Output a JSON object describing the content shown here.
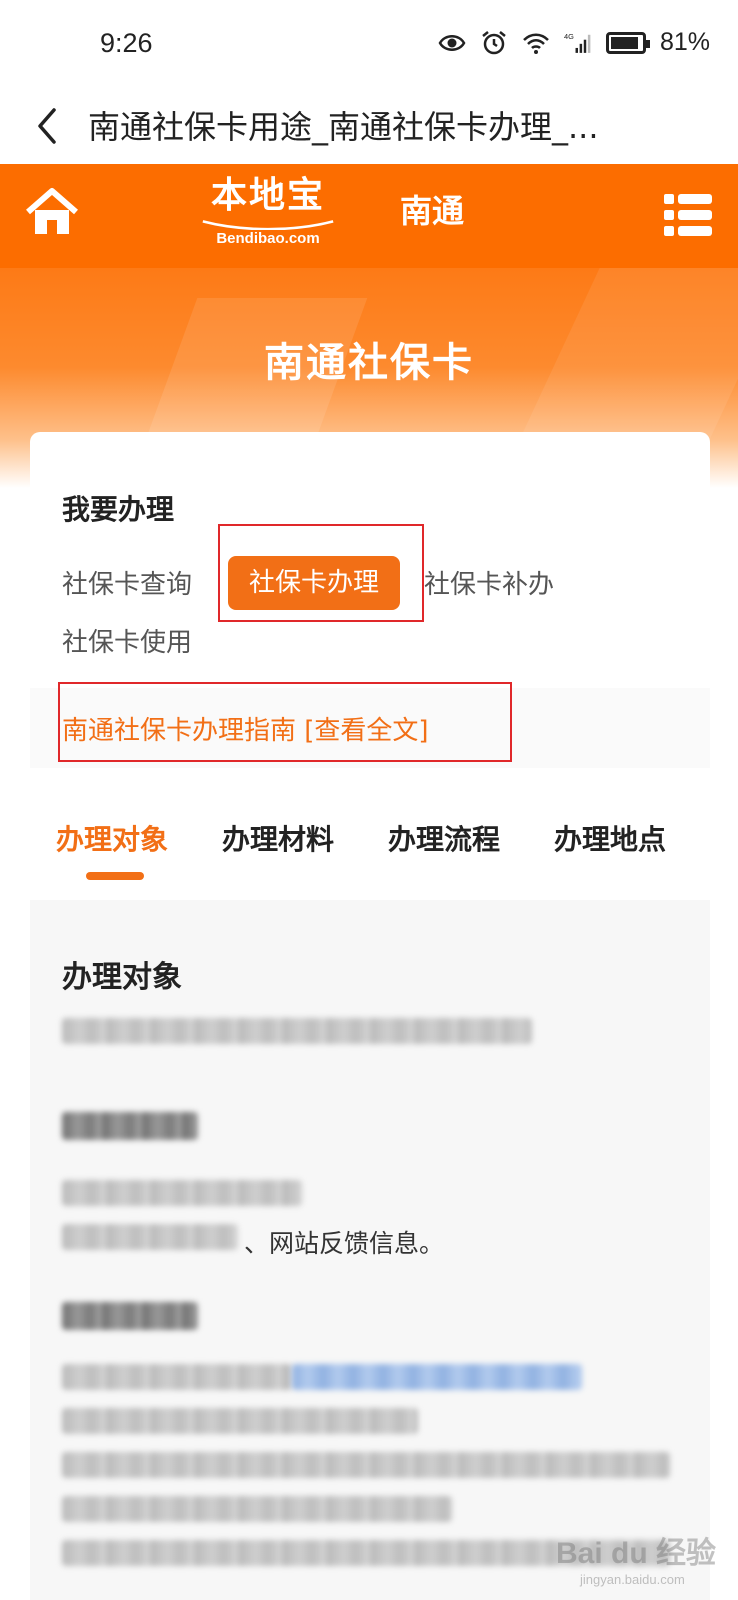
{
  "status_bar": {
    "time": "9:26",
    "battery": "81%",
    "network": "4G"
  },
  "title_bar": {
    "title": "南通社保卡用途_南通社保卡办理_..."
  },
  "header": {
    "logo_text": "本地宝",
    "logo_domain": "Bendibao.com",
    "city": "南通",
    "brand_color": "#fc6d00"
  },
  "hero": {
    "title": "南通社保卡"
  },
  "card": {
    "heading": "我要办理",
    "options": [
      {
        "label": "社保卡查询",
        "active": false
      },
      {
        "label": "社保卡办理",
        "active": true
      },
      {
        "label": "社保卡补办",
        "active": false
      },
      {
        "label": "社保卡使用",
        "active": false
      }
    ],
    "guide_link": "南通社保卡办理指南 [查看全文]"
  },
  "tabs": [
    {
      "label": "办理对象",
      "active": true
    },
    {
      "label": "办理材料",
      "active": false
    },
    {
      "label": "办理流程",
      "active": false
    },
    {
      "label": "办理地点",
      "active": false
    }
  ],
  "content": {
    "heading": "办理对象",
    "visible_fragment": "、网站反馈信息。"
  },
  "watermark": {
    "brand": "Bai du 经验",
    "url": "jingyan.baidu.com"
  },
  "colors": {
    "accent": "#f26f16",
    "highlight_border": "#e0282a"
  }
}
